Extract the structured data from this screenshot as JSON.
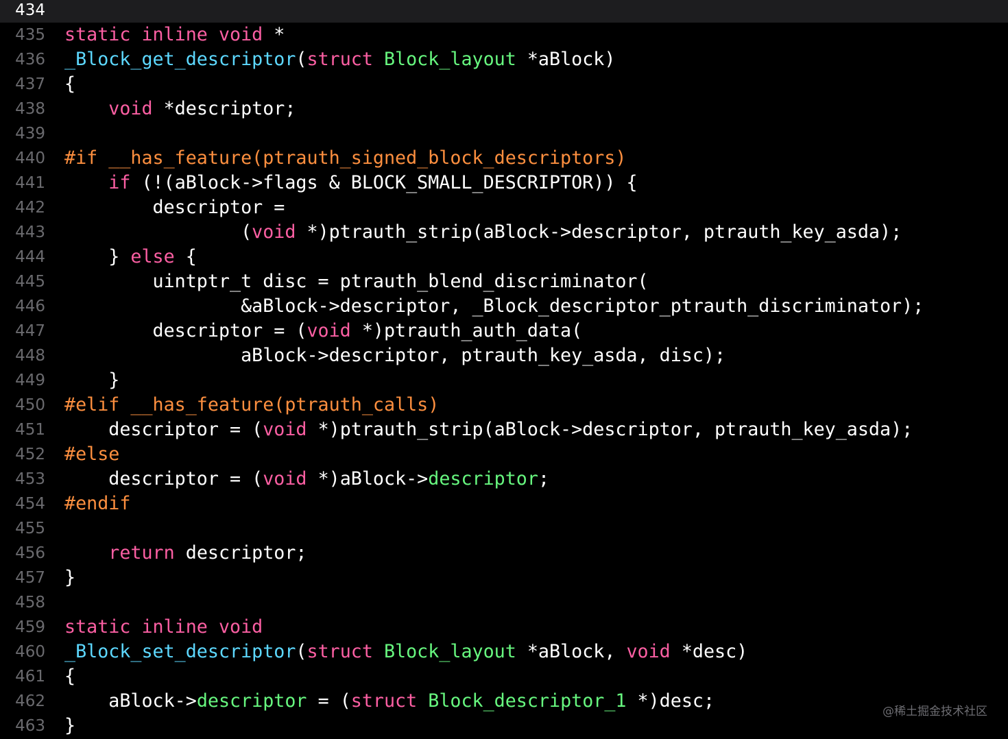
{
  "theme": {
    "background": "#000000",
    "current_line_bg": "#1d1d1f",
    "gutter_color": "#6a6a6e",
    "plain": "#ffffff",
    "keyword": "#fc5fa3",
    "function_name": "#5dd8ff",
    "type_name": "#67f77f",
    "preprocessor": "#fd8f3f"
  },
  "editor": {
    "current_line": 434,
    "lines": [
      {
        "n": "434",
        "current": true,
        "tokens": []
      },
      {
        "n": "435",
        "tokens": [
          {
            "t": "static inline void",
            "c": "kw"
          },
          {
            "t": " *",
            "c": "plain"
          }
        ]
      },
      {
        "n": "436",
        "tokens": [
          {
            "t": "_Block_get_descriptor",
            "c": "type"
          },
          {
            "t": "(",
            "c": "plain"
          },
          {
            "t": "struct",
            "c": "kw"
          },
          {
            "t": " ",
            "c": "plain"
          },
          {
            "t": "Block_layout",
            "c": "cls"
          },
          {
            "t": " *aBlock)",
            "c": "plain"
          }
        ]
      },
      {
        "n": "437",
        "tokens": [
          {
            "t": "{",
            "c": "plain"
          }
        ]
      },
      {
        "n": "438",
        "tokens": [
          {
            "t": "    ",
            "c": "plain"
          },
          {
            "t": "void",
            "c": "kw"
          },
          {
            "t": " *descriptor;",
            "c": "plain"
          }
        ]
      },
      {
        "n": "439",
        "tokens": []
      },
      {
        "n": "440",
        "tokens": [
          {
            "t": "#if __has_feature(ptrauth_signed_block_descriptors)",
            "c": "pp"
          }
        ]
      },
      {
        "n": "441",
        "tokens": [
          {
            "t": "    ",
            "c": "plain"
          },
          {
            "t": "if",
            "c": "kw"
          },
          {
            "t": " (!(aBlock->flags & BLOCK_SMALL_DESCRIPTOR)) {",
            "c": "plain"
          }
        ]
      },
      {
        "n": "442",
        "tokens": [
          {
            "t": "        descriptor =",
            "c": "plain"
          }
        ]
      },
      {
        "n": "443",
        "tokens": [
          {
            "t": "                (",
            "c": "plain"
          },
          {
            "t": "void",
            "c": "kw"
          },
          {
            "t": " *)ptrauth_strip(aBlock->descriptor, ptrauth_key_asda);",
            "c": "plain"
          }
        ]
      },
      {
        "n": "444",
        "tokens": [
          {
            "t": "    } ",
            "c": "plain"
          },
          {
            "t": "else",
            "c": "kw"
          },
          {
            "t": " {",
            "c": "plain"
          }
        ]
      },
      {
        "n": "445",
        "tokens": [
          {
            "t": "        uintptr_t disc = ptrauth_blend_discriminator(",
            "c": "plain"
          }
        ]
      },
      {
        "n": "446",
        "tokens": [
          {
            "t": "                &aBlock->descriptor, _Block_descriptor_ptrauth_discriminator);",
            "c": "plain"
          }
        ]
      },
      {
        "n": "447",
        "tokens": [
          {
            "t": "        descriptor = (",
            "c": "plain"
          },
          {
            "t": "void",
            "c": "kw"
          },
          {
            "t": " *)ptrauth_auth_data(",
            "c": "plain"
          }
        ]
      },
      {
        "n": "448",
        "tokens": [
          {
            "t": "                aBlock->descriptor, ptrauth_key_asda, disc);",
            "c": "plain"
          }
        ]
      },
      {
        "n": "449",
        "tokens": [
          {
            "t": "    }",
            "c": "plain"
          }
        ]
      },
      {
        "n": "450",
        "tokens": [
          {
            "t": "#elif __has_feature(ptrauth_calls)",
            "c": "pp"
          }
        ]
      },
      {
        "n": "451",
        "tokens": [
          {
            "t": "    descriptor = (",
            "c": "plain"
          },
          {
            "t": "void",
            "c": "kw"
          },
          {
            "t": " *)ptrauth_strip(aBlock->descriptor, ptrauth_key_asda);",
            "c": "plain"
          }
        ]
      },
      {
        "n": "452",
        "tokens": [
          {
            "t": "#else",
            "c": "pp"
          }
        ]
      },
      {
        "n": "453",
        "tokens": [
          {
            "t": "    descriptor = (",
            "c": "plain"
          },
          {
            "t": "void",
            "c": "kw"
          },
          {
            "t": " *)aBlock->",
            "c": "plain"
          },
          {
            "t": "descriptor",
            "c": "cls"
          },
          {
            "t": ";",
            "c": "plain"
          }
        ]
      },
      {
        "n": "454",
        "tokens": [
          {
            "t": "#endif",
            "c": "pp"
          }
        ]
      },
      {
        "n": "455",
        "tokens": []
      },
      {
        "n": "456",
        "tokens": [
          {
            "t": "    ",
            "c": "plain"
          },
          {
            "t": "return",
            "c": "kw"
          },
          {
            "t": " descriptor;",
            "c": "plain"
          }
        ]
      },
      {
        "n": "457",
        "tokens": [
          {
            "t": "}",
            "c": "plain"
          }
        ]
      },
      {
        "n": "458",
        "tokens": []
      },
      {
        "n": "459",
        "tokens": [
          {
            "t": "static inline void",
            "c": "kw"
          }
        ]
      },
      {
        "n": "460",
        "tokens": [
          {
            "t": "_Block_set_descriptor",
            "c": "type"
          },
          {
            "t": "(",
            "c": "plain"
          },
          {
            "t": "struct",
            "c": "kw"
          },
          {
            "t": " ",
            "c": "plain"
          },
          {
            "t": "Block_layout",
            "c": "cls"
          },
          {
            "t": " *aBlock, ",
            "c": "plain"
          },
          {
            "t": "void",
            "c": "kw"
          },
          {
            "t": " *desc)",
            "c": "plain"
          }
        ]
      },
      {
        "n": "461",
        "tokens": [
          {
            "t": "{",
            "c": "plain"
          }
        ]
      },
      {
        "n": "462",
        "tokens": [
          {
            "t": "    aBlock->",
            "c": "plain"
          },
          {
            "t": "descriptor",
            "c": "cls"
          },
          {
            "t": " = (",
            "c": "plain"
          },
          {
            "t": "struct",
            "c": "kw"
          },
          {
            "t": " ",
            "c": "plain"
          },
          {
            "t": "Block_descriptor_1",
            "c": "cls"
          },
          {
            "t": " *)desc;",
            "c": "plain"
          }
        ]
      },
      {
        "n": "463",
        "tokens": [
          {
            "t": "}",
            "c": "plain"
          }
        ]
      }
    ]
  },
  "watermark": "@稀土掘金技术社区"
}
